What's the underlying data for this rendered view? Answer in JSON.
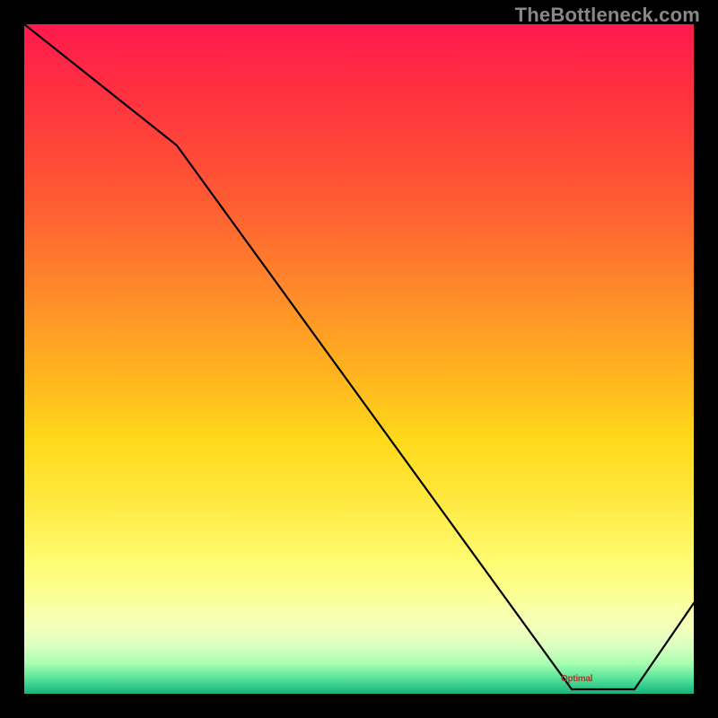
{
  "watermark": "TheBottleneck.com",
  "annotation_label": "Optimal",
  "chart_data": {
    "type": "line",
    "title": "",
    "xlabel": "",
    "ylabel": "",
    "x": [
      0,
      18,
      82,
      90,
      100
    ],
    "values": [
      100,
      82,
      0,
      0,
      13
    ],
    "ylim": [
      0,
      100
    ],
    "xlim": [
      0,
      100
    ],
    "annotations": [
      {
        "text": "Optimal",
        "x": 86,
        "y": 1
      }
    ],
    "background": "vertical-gradient red→yellow→green",
    "grid": false,
    "legend": false
  }
}
